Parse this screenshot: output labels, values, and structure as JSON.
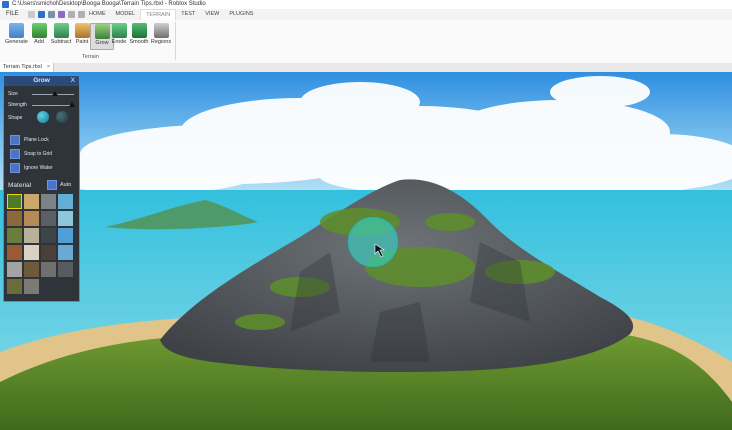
{
  "window": {
    "title": "C:\\Users\\smichol\\Desktop\\Booga Booga\\Terrain Tips.rbxl - Roblox Studio"
  },
  "menu": {
    "file": "FILE",
    "tabs": [
      "HOME",
      "MODEL",
      "TERRAIN",
      "TEST",
      "VIEW",
      "PLUGINS"
    ],
    "active_tab": "TERRAIN"
  },
  "ribbon": {
    "group_label": "Terrain",
    "tools": [
      {
        "label": "Generate",
        "icon": "terrain-generate-icon",
        "color": "#3f7fc8"
      },
      {
        "label": "Add",
        "icon": "terrain-add-icon",
        "color": "#3c9c3c"
      },
      {
        "label": "Subtract",
        "icon": "terrain-subtract-icon",
        "color": "#3c8f55"
      },
      {
        "label": "Paint",
        "icon": "terrain-paint-icon",
        "color": "#c78a2f"
      },
      {
        "label": "Grow",
        "icon": "terrain-grow-icon",
        "color": "#4f8f4f"
      },
      {
        "label": "Erode",
        "icon": "terrain-erode-icon",
        "color": "#3c8f55"
      },
      {
        "label": "Smooth",
        "icon": "terrain-smooth-icon",
        "color": "#2f7f4a"
      },
      {
        "label": "Regions",
        "icon": "terrain-regions-icon",
        "color": "#777777"
      }
    ],
    "selected": "Grow"
  },
  "document_tab": {
    "label": "Terrain Tips.rbxl",
    "close": "×"
  },
  "grow_panel": {
    "title": "Grow",
    "close": "X",
    "size_label": "Size",
    "strength_label": "Strength",
    "shape_label": "Shape",
    "size_value": 0.55,
    "strength_value": 0.95,
    "options": [
      {
        "label": "Plane Lock"
      },
      {
        "label": "Snap to Grid"
      },
      {
        "label": "Ignore Water"
      }
    ],
    "material_label": "Material",
    "auto_label": "Auto",
    "materials": [
      {
        "name": "grass",
        "color": "#4f7a2a",
        "selected": true
      },
      {
        "name": "sand",
        "color": "#c9a86a"
      },
      {
        "name": "rock",
        "color": "#7c8288"
      },
      {
        "name": "water",
        "color": "#5fb0d4"
      },
      {
        "name": "wood-planks",
        "color": "#8a6a3c"
      },
      {
        "name": "sandstone",
        "color": "#b58a54"
      },
      {
        "name": "slate",
        "color": "#5a6066"
      },
      {
        "name": "glacier",
        "color": "#8ec6dc"
      },
      {
        "name": "leafy-grass",
        "color": "#6a7d3a"
      },
      {
        "name": "limestone",
        "color": "#b9b09a"
      },
      {
        "name": "basalt",
        "color": "#3f4448"
      },
      {
        "name": "ice",
        "color": "#4f9fd8"
      },
      {
        "name": "brick",
        "color": "#9a5a32"
      },
      {
        "name": "salt",
        "color": "#d9d2c2"
      },
      {
        "name": "cracked-lava",
        "color": "#4a4038"
      },
      {
        "name": "snow",
        "color": "#6aa9d4"
      },
      {
        "name": "concrete",
        "color": "#a3a3a3"
      },
      {
        "name": "mud",
        "color": "#6e5a3a"
      },
      {
        "name": "pavement",
        "color": "#6f6f6f"
      },
      {
        "name": "asphalt",
        "color": "#555b5e"
      },
      {
        "name": "ground",
        "color": "#6a6c3a"
      },
      {
        "name": "cobblestone",
        "color": "#7c7a74"
      }
    ]
  }
}
